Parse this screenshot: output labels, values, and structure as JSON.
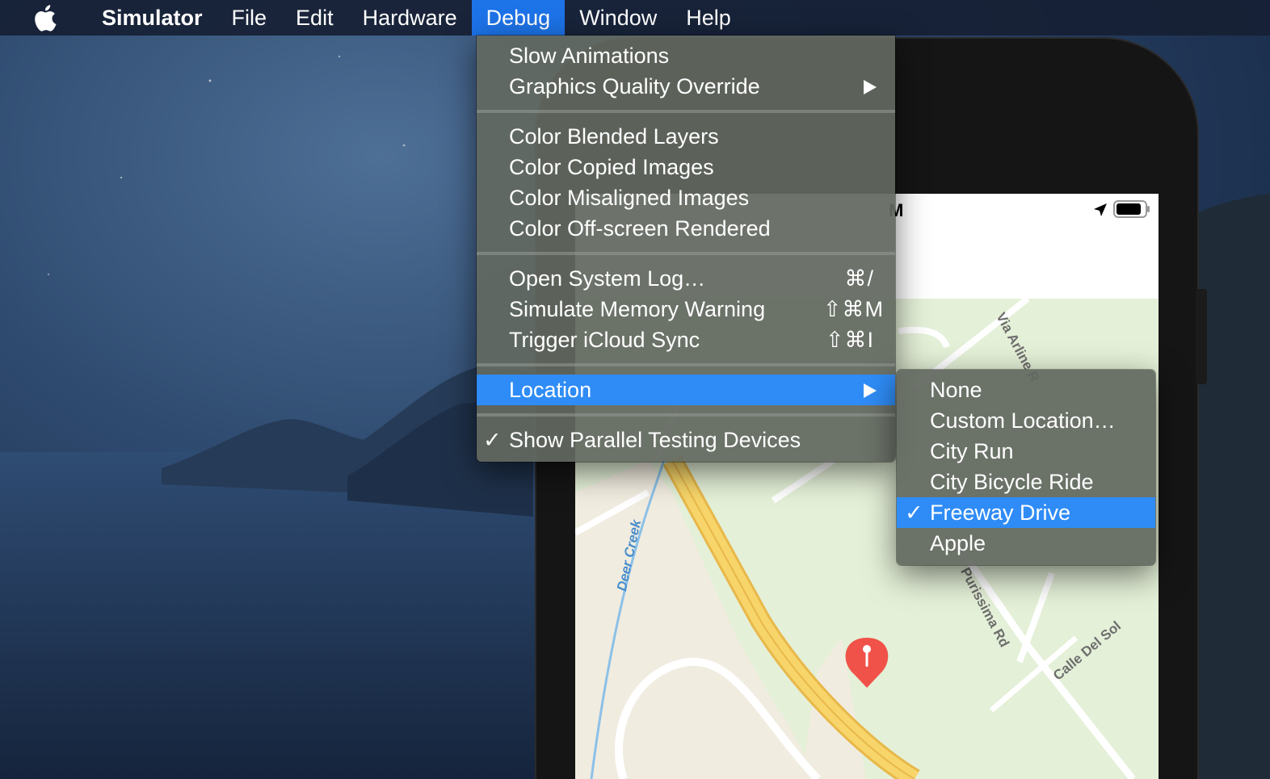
{
  "menubar": {
    "app_name": "Simulator",
    "items": [
      "File",
      "Edit",
      "Hardware",
      "Debug",
      "Window",
      "Help"
    ],
    "active_item": "Debug"
  },
  "debug_menu": {
    "group1": [
      {
        "label": "Slow Animations"
      },
      {
        "label": "Graphics Quality Override",
        "submenu": true
      }
    ],
    "group2": [
      {
        "label": "Color Blended Layers"
      },
      {
        "label": "Color Copied Images"
      },
      {
        "label": "Color Misaligned Images"
      },
      {
        "label": "Color Off-screen Rendered"
      }
    ],
    "group3": [
      {
        "label": "Open System Log…",
        "shortcut": "⌘/"
      },
      {
        "label": "Simulate Memory Warning",
        "shortcut": "⇧⌘M"
      },
      {
        "label": "Trigger iCloud Sync",
        "shortcut": "⇧⌘I"
      }
    ],
    "location": {
      "label": "Location",
      "submenu": true,
      "highlighted": true
    },
    "parallel": {
      "label": "Show Parallel Testing Devices",
      "checked": true,
      "check_mark": "✓"
    }
  },
  "location_menu": {
    "items": [
      {
        "label": "None"
      },
      {
        "label": "Custom Location…"
      },
      {
        "label": "City Run"
      },
      {
        "label": "City Bicycle Ride"
      },
      {
        "label": "Freeway Drive",
        "checked": true,
        "highlighted": true
      },
      {
        "label": "Apple"
      }
    ],
    "check_mark": "✓"
  },
  "device": {
    "status_time_fragment": "M",
    "map_labels": {
      "via_arline": "Via Arline R",
      "deer_creek": "Deer Creek",
      "purissima": "Purissima Rd",
      "calle_del_sol": "Calle Del Sol"
    }
  },
  "colors": {
    "menu_highlight": "#2f8cf6",
    "menubar_active": "#1d73e8",
    "map_pin": "#f0524a",
    "freeway": "#f7d56a"
  }
}
